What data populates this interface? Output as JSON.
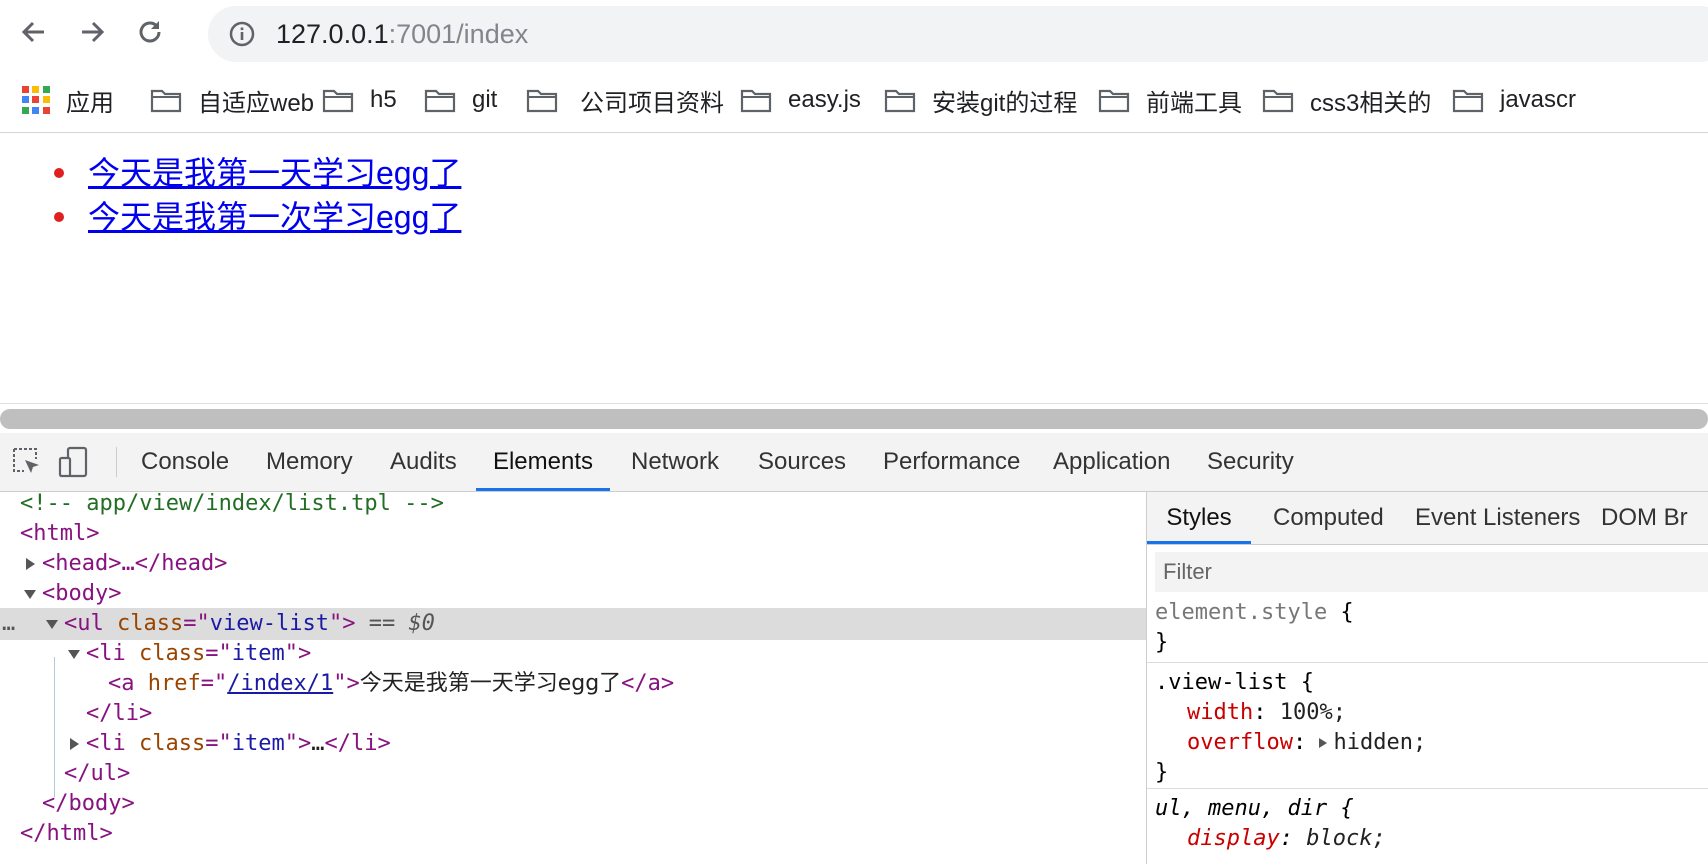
{
  "browser": {
    "url_host": "127.0.0.1",
    "url_rest": ":7001/index"
  },
  "bookmarks": [
    {
      "label": "应用",
      "icon": "apps-grid-icon"
    },
    {
      "label": "自适应web",
      "icon": "folder-icon"
    },
    {
      "label": "h5",
      "icon": "folder-icon"
    },
    {
      "label": "git",
      "icon": "folder-icon"
    },
    {
      "label": "公司项目资料",
      "icon": "folder-icon"
    },
    {
      "label": "easy.js",
      "icon": "folder-icon"
    },
    {
      "label": "安装git的过程",
      "icon": "folder-icon"
    },
    {
      "label": "前端工具",
      "icon": "folder-icon"
    },
    {
      "label": "css3相关的",
      "icon": "folder-icon"
    },
    {
      "label": "javascr",
      "icon": "folder-icon"
    }
  ],
  "page": {
    "items": [
      {
        "text": "今天是我第一天学习egg了"
      },
      {
        "text": "今天是我第一次学习egg了"
      }
    ]
  },
  "devtools": {
    "tabs": [
      "Console",
      "Memory",
      "Audits",
      "Elements",
      "Network",
      "Sources",
      "Performance",
      "Application",
      "Security"
    ],
    "active_tab": "Elements",
    "dom": {
      "comment": "<!-- app/view/index/list.tpl -->",
      "html_open": "<html>",
      "head": "<head>…</head>",
      "body_open": "<body>",
      "ul_tag": "ul",
      "ul_attr": "class",
      "ul_val": "view-list",
      "selected_marker": "== $0",
      "li_tag": "li",
      "li_attr": "class",
      "li_val": "item",
      "a_attr": "href",
      "a_href": "/index/1",
      "a_text": "今天是我第一天学习egg了",
      "li_close": "</li>",
      "li_collapsed_text": "…",
      "ul_close": "</ul>",
      "body_close": "</body>",
      "html_close": "</html>"
    },
    "styles": {
      "tabs": [
        "Styles",
        "Computed",
        "Event Listeners",
        "DOM Br"
      ],
      "active_tab": "Styles",
      "filter_placeholder": "Filter",
      "rules": [
        {
          "selector": "element.style",
          "props": []
        },
        {
          "selector": ".view-list",
          "props": [
            {
              "name": "width",
              "value": "100%;"
            },
            {
              "name": "overflow",
              "value": "hidden;"
            }
          ]
        },
        {
          "selector": "ul, menu, dir",
          "props": [
            {
              "name": "display",
              "value": "block;"
            }
          ]
        }
      ]
    }
  },
  "colors": {
    "bullet": "#e02020",
    "link": "#0000ee",
    "active_tab_underline": "#1a73e8"
  }
}
